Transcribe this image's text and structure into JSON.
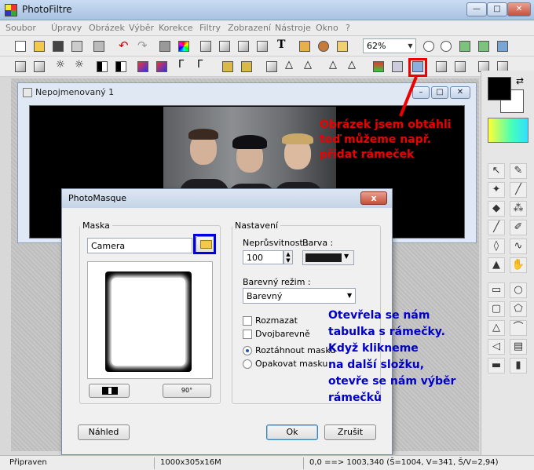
{
  "app": {
    "title": "PhotoFiltre",
    "min": "—",
    "max": "□",
    "close": "✕"
  },
  "menu": [
    "Soubor",
    "Úpravy",
    "Obrázek",
    "Výběr",
    "Korekce",
    "Filtry",
    "Zobrazení",
    "Nástroje",
    "Okno",
    "?"
  ],
  "toolbar": {
    "zoom": "62%"
  },
  "document": {
    "title": "Nepojmenovaný 1",
    "min": "–",
    "max": "□",
    "close": "✕"
  },
  "annotations": {
    "red": [
      "Obrázek jsem obtáhli",
      "teď můžeme např.",
      "přidat rámeček"
    ],
    "blue": [
      "Otevřela se nám",
      "tabulka s rámečky.",
      "Když klikneme",
      "na další složku,",
      "otevře se nám výběr",
      "rámečků"
    ]
  },
  "dialog": {
    "title": "PhotoMasque",
    "close": "x",
    "mask_group": "Maska",
    "mask_value": "Camera",
    "settings_group": "Nastavení",
    "opacity_label": "Neprůsvitnost :",
    "opacity_value": "100",
    "color_label": "Barva :",
    "color_mode_label": "Barevný režim :",
    "color_mode_value": "Barevný",
    "blur_label": "Rozmazat",
    "bicolor_label": "Dvojbarevně",
    "stretch_label": "Roztáhnout masku",
    "repeat_label": "Opakovat masku",
    "rotate_label": "90°",
    "preview_button": "Náhled",
    "ok_button": "Ok",
    "cancel_button": "Zrušit"
  },
  "status": {
    "state": "Připraven",
    "size": "1000x305x16M",
    "coords": "0,0 ==> 1003,340 (Š=1004, V=341, Š/V=2,94)"
  },
  "colors": {
    "annotation_red": "#e00000",
    "annotation_blue": "#0000e0",
    "foreground": "#000000",
    "background": "#ffffff"
  }
}
